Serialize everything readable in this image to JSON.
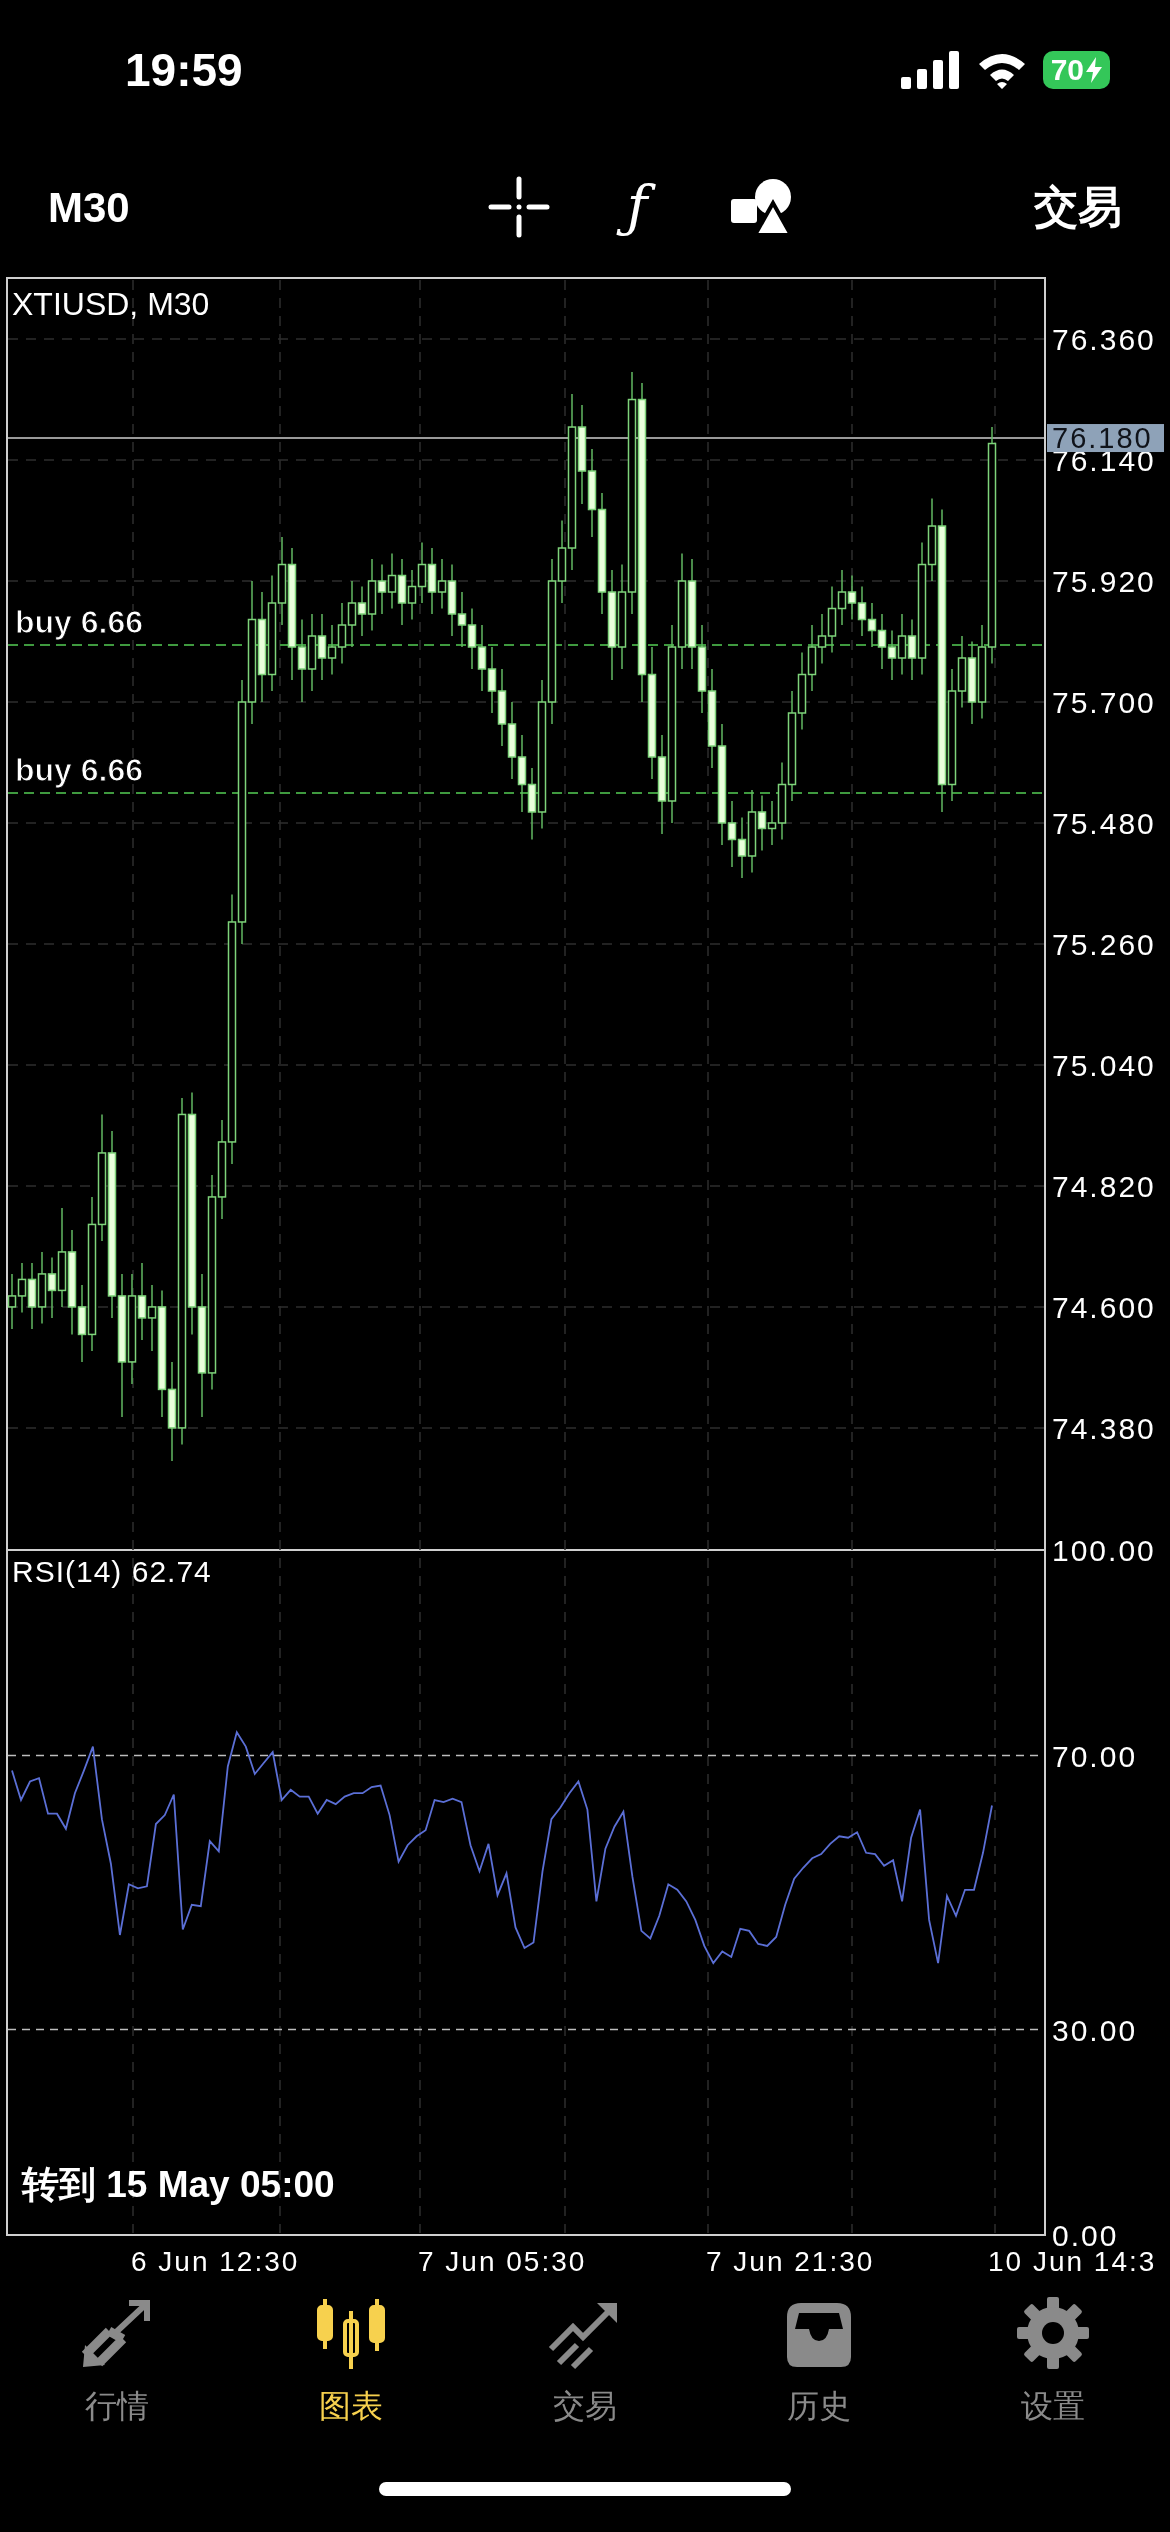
{
  "status_bar": {
    "time": "19:59",
    "battery": "70"
  },
  "toolbar": {
    "timeframe": "M30",
    "tools": [
      {
        "kind": "crosshair"
      },
      {
        "kind": "glyph",
        "label": "ƒ"
      },
      {
        "kind": "shapes"
      }
    ],
    "action": "交易"
  },
  "price_chart": {
    "title": "XTIUSD, M30",
    "current_price": "76.180",
    "orders": [
      {
        "label": "buy 6.66"
      },
      {
        "label": "buy 6.66"
      }
    ],
    "chart_data": {
      "type": "candlestick",
      "ylim": [
        74.158,
        76.471
      ],
      "yticks": [
        {
          "value": 76.36,
          "label": "76.360"
        },
        {
          "value": 76.14,
          "label": "76.140"
        },
        {
          "value": 75.92,
          "label": "75.920"
        },
        {
          "value": 75.7,
          "label": "75.700"
        },
        {
          "value": 75.48,
          "label": "75.480"
        },
        {
          "value": 75.26,
          "label": "75.260"
        },
        {
          "value": 75.04,
          "label": "75.040"
        },
        {
          "value": 74.82,
          "label": "74.820"
        },
        {
          "value": 74.6,
          "label": "74.600"
        },
        {
          "value": 74.38,
          "label": "74.380"
        }
      ],
      "ohlc": [
        [
          74.6,
          74.66,
          74.56,
          74.62
        ],
        [
          74.62,
          74.68,
          74.59,
          74.65
        ],
        [
          74.65,
          74.68,
          74.56,
          74.6
        ],
        [
          74.6,
          74.7,
          74.57,
          74.66
        ],
        [
          74.66,
          74.69,
          74.58,
          74.63
        ],
        [
          74.63,
          74.78,
          74.6,
          74.7
        ],
        [
          74.7,
          74.74,
          74.55,
          74.6
        ],
        [
          74.6,
          74.64,
          74.5,
          74.55
        ],
        [
          74.55,
          74.8,
          74.52,
          74.75
        ],
        [
          74.75,
          74.95,
          74.72,
          74.88
        ],
        [
          74.88,
          74.92,
          74.58,
          74.62
        ],
        [
          74.62,
          74.66,
          74.4,
          74.5
        ],
        [
          74.5,
          74.66,
          74.46,
          74.62
        ],
        [
          74.62,
          74.68,
          74.54,
          74.58
        ],
        [
          74.58,
          74.64,
          74.52,
          74.6
        ],
        [
          74.6,
          74.63,
          74.4,
          74.45
        ],
        [
          74.45,
          74.5,
          74.32,
          74.38
        ],
        [
          74.38,
          74.98,
          74.35,
          74.95
        ],
        [
          74.95,
          74.99,
          74.55,
          74.6
        ],
        [
          74.6,
          74.66,
          74.4,
          74.48
        ],
        [
          74.48,
          74.84,
          74.45,
          74.8
        ],
        [
          74.8,
          74.94,
          74.76,
          74.9
        ],
        [
          74.9,
          75.35,
          74.86,
          75.3
        ],
        [
          75.3,
          75.74,
          75.26,
          75.7
        ],
        [
          75.7,
          75.92,
          75.66,
          75.85
        ],
        [
          75.85,
          75.9,
          75.7,
          75.75
        ],
        [
          75.75,
          75.93,
          75.72,
          75.88
        ],
        [
          75.88,
          76.0,
          75.84,
          75.95
        ],
        [
          75.95,
          75.98,
          75.74,
          75.8
        ],
        [
          75.8,
          75.85,
          75.7,
          75.76
        ],
        [
          75.76,
          75.86,
          75.72,
          75.82
        ],
        [
          75.82,
          75.86,
          75.74,
          75.78
        ],
        [
          75.78,
          75.84,
          75.75,
          75.8
        ],
        [
          75.8,
          75.88,
          75.77,
          75.84
        ],
        [
          75.84,
          75.92,
          75.8,
          75.88
        ],
        [
          75.88,
          75.91,
          75.82,
          75.86
        ],
        [
          75.86,
          75.96,
          75.83,
          75.92
        ],
        [
          75.92,
          75.95,
          75.86,
          75.9
        ],
        [
          75.9,
          75.97,
          75.87,
          75.93
        ],
        [
          75.93,
          75.96,
          75.84,
          75.88
        ],
        [
          75.88,
          75.94,
          75.85,
          75.91
        ],
        [
          75.91,
          75.99,
          75.88,
          75.95
        ],
        [
          75.95,
          75.98,
          75.86,
          75.9
        ],
        [
          75.9,
          75.96,
          75.87,
          75.92
        ],
        [
          75.92,
          75.95,
          75.82,
          75.86
        ],
        [
          75.86,
          75.9,
          75.8,
          75.84
        ],
        [
          75.84,
          75.87,
          75.76,
          75.8
        ],
        [
          75.8,
          75.84,
          75.72,
          75.76
        ],
        [
          75.76,
          75.8,
          75.68,
          75.72
        ],
        [
          75.72,
          75.76,
          75.62,
          75.66
        ],
        [
          75.66,
          75.7,
          75.56,
          75.6
        ],
        [
          75.6,
          75.64,
          75.5,
          75.55
        ],
        [
          75.55,
          75.58,
          75.45,
          75.5
        ],
        [
          75.5,
          75.74,
          75.47,
          75.7
        ],
        [
          75.7,
          75.96,
          75.66,
          75.92
        ],
        [
          75.92,
          76.03,
          75.88,
          75.98
        ],
        [
          75.98,
          76.26,
          75.94,
          76.2
        ],
        [
          76.2,
          76.24,
          76.06,
          76.12
        ],
        [
          76.12,
          76.16,
          76.0,
          76.05
        ],
        [
          76.05,
          76.08,
          75.86,
          75.9
        ],
        [
          75.9,
          75.94,
          75.74,
          75.8
        ],
        [
          75.8,
          75.95,
          75.76,
          75.9
        ],
        [
          75.9,
          76.3,
          75.86,
          76.25
        ],
        [
          76.25,
          76.28,
          75.7,
          75.75
        ],
        [
          75.75,
          75.8,
          75.56,
          75.6
        ],
        [
          75.6,
          75.64,
          75.46,
          75.52
        ],
        [
          75.52,
          75.84,
          75.48,
          75.8
        ],
        [
          75.8,
          75.97,
          75.76,
          75.92
        ],
        [
          75.92,
          75.96,
          75.76,
          75.8
        ],
        [
          75.8,
          75.84,
          75.68,
          75.72
        ],
        [
          75.72,
          75.76,
          75.58,
          75.62
        ],
        [
          75.62,
          75.66,
          75.44,
          75.48
        ],
        [
          75.48,
          75.52,
          75.4,
          75.45
        ],
        [
          75.45,
          75.49,
          75.38,
          75.42
        ],
        [
          75.42,
          75.54,
          75.39,
          75.5
        ],
        [
          75.5,
          75.53,
          75.43,
          75.47
        ],
        [
          75.47,
          75.52,
          75.44,
          75.48
        ],
        [
          75.48,
          75.59,
          75.45,
          75.55
        ],
        [
          75.55,
          75.72,
          75.52,
          75.68
        ],
        [
          75.68,
          75.79,
          75.65,
          75.75
        ],
        [
          75.75,
          75.84,
          75.72,
          75.8
        ],
        [
          75.8,
          75.86,
          75.77,
          75.82
        ],
        [
          75.82,
          75.91,
          75.79,
          75.87
        ],
        [
          75.87,
          75.94,
          75.84,
          75.9
        ],
        [
          75.9,
          75.93,
          75.85,
          75.88
        ],
        [
          75.88,
          75.91,
          75.82,
          75.85
        ],
        [
          75.85,
          75.88,
          75.8,
          75.83
        ],
        [
          75.83,
          75.86,
          75.76,
          75.8
        ],
        [
          75.8,
          75.83,
          75.74,
          75.78
        ],
        [
          75.78,
          75.86,
          75.75,
          75.82
        ],
        [
          75.82,
          75.85,
          75.74,
          75.78
        ],
        [
          75.78,
          75.99,
          75.75,
          75.95
        ],
        [
          75.95,
          76.07,
          75.92,
          76.02
        ],
        [
          76.02,
          76.05,
          75.5,
          75.55
        ],
        [
          75.55,
          75.76,
          75.52,
          75.72
        ],
        [
          75.72,
          75.82,
          75.69,
          75.78
        ],
        [
          75.78,
          75.81,
          75.66,
          75.7
        ],
        [
          75.7,
          75.84,
          75.67,
          75.8
        ],
        [
          75.8,
          76.2,
          75.77,
          76.17
        ]
      ]
    }
  },
  "rsi_panel": {
    "value": "62.74",
    "chart_data": {
      "type": "line",
      "ylim": [
        0,
        100
      ],
      "yticks": [
        {
          "value": 100,
          "label": "100.00"
        },
        {
          "value": 70,
          "label": "70.00"
        },
        {
          "value": 30,
          "label": "30.00"
        },
        {
          "value": 0,
          "label": "0.00"
        }
      ],
      "series": [
        {
          "name": "RSI(14)",
          "color": "#5b6fd6",
          "values": [
            67.8,
            63.5,
            66.2,
            66.7,
            61.5,
            61.5,
            59.3,
            64.5,
            67.8,
            71.3,
            60.7,
            54.2,
            43.8,
            51.2,
            50.6,
            50.9,
            60.0,
            61.3,
            64.3,
            44.6,
            48.2,
            48.0,
            57.5,
            56.0,
            68.4,
            73.4,
            71.3,
            67.3,
            68.9,
            70.5,
            63.5,
            65.0,
            64.0,
            64.0,
            61.5,
            63.5,
            62.9,
            64.0,
            64.5,
            64.5,
            65.4,
            65.6,
            61.3,
            54.5,
            56.9,
            58.2,
            59.1,
            63.5,
            63.2,
            63.7,
            63.2,
            56.9,
            53.1,
            57.1,
            49.6,
            52.8,
            44.9,
            41.9,
            42.7,
            53.1,
            60.7,
            62.4,
            64.5,
            66.2,
            62.1,
            48.7,
            56.4,
            59.6,
            61.8,
            52.3,
            44.4,
            43.3,
            46.6,
            51.2,
            50.4,
            48.7,
            46.0,
            42.2,
            39.7,
            41.4,
            40.6,
            44.7,
            44.4,
            42.5,
            42.2,
            43.5,
            48.2,
            52.0,
            53.6,
            55.0,
            55.6,
            57.1,
            58.2,
            58.0,
            58.8,
            55.8,
            55.6,
            53.9,
            54.7,
            48.7,
            58.0,
            62.1,
            46.0,
            39.7,
            49.5,
            46.6,
            50.4,
            50.4,
            55.8,
            62.7
          ]
        }
      ]
    }
  },
  "goto_link": "转到 15 May 05:00",
  "time_axis": [
    "6 Jun 12:30",
    "7 Jun 05:30",
    "7 Jun 21:30",
    "10 Jun 14:3"
  ],
  "tabs": [
    {
      "label": "行情",
      "selected": false
    },
    {
      "label": "图表",
      "selected": true
    },
    {
      "label": "交易",
      "selected": false
    },
    {
      "label": "历史",
      "selected": false
    },
    {
      "label": "设置",
      "selected": false
    }
  ]
}
